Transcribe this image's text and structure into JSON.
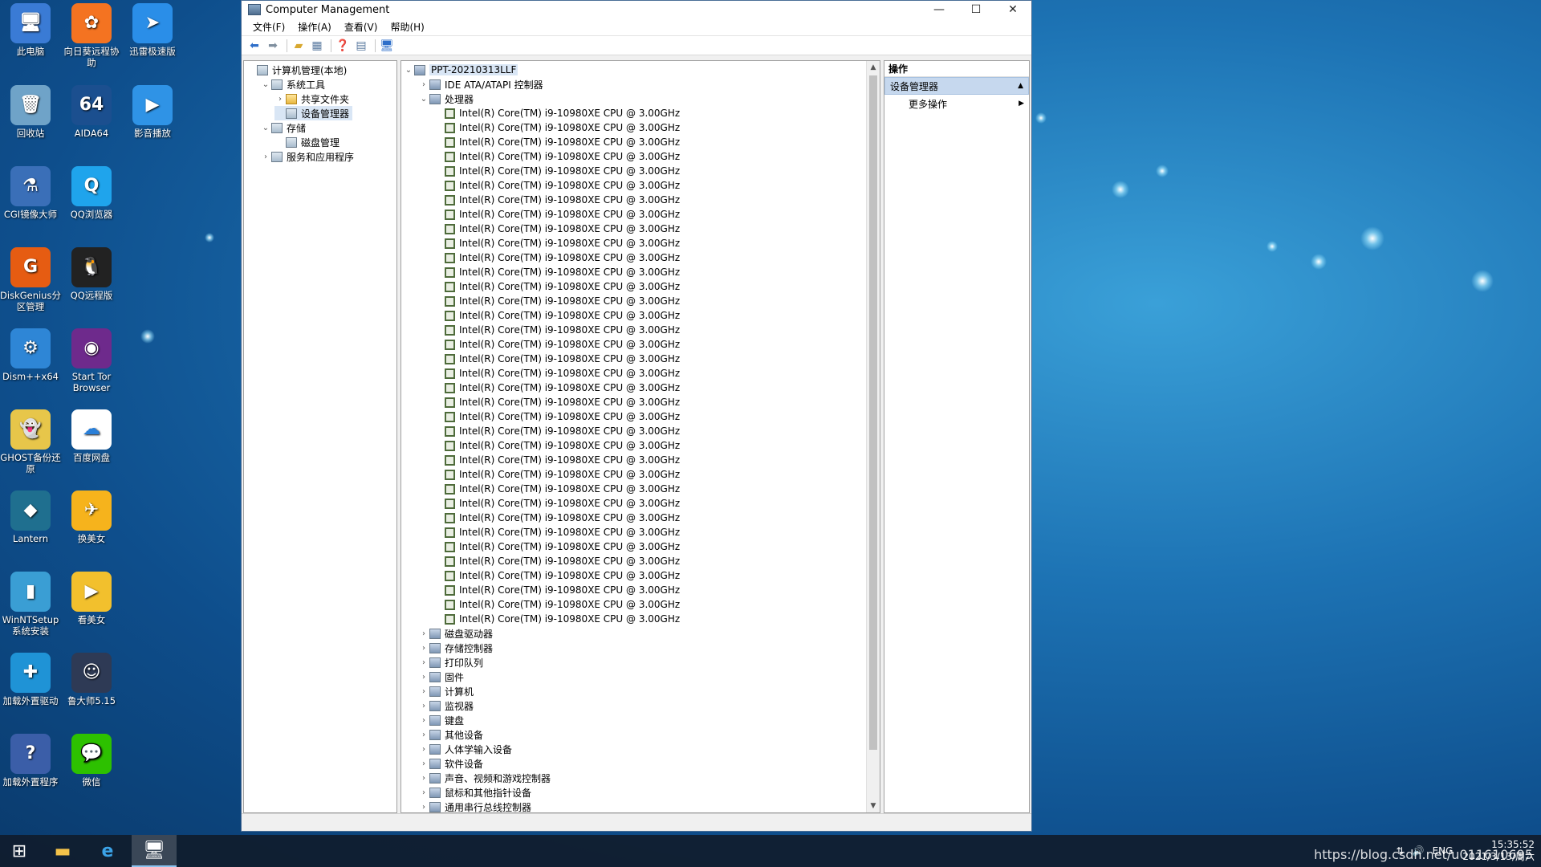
{
  "desktop": {
    "icons": [
      {
        "label": "此电脑",
        "glyph": "🖥",
        "color": "#3a7bd5"
      },
      {
        "label": "向日葵远程协助",
        "glyph": "✿",
        "color": "#f47321"
      },
      {
        "label": "迅雷极速版",
        "glyph": "➤",
        "color": "#2a8ee8"
      },
      {
        "label": "回收站",
        "glyph": "🗑",
        "color": "#6fa3c8"
      },
      {
        "label": "AIDA64",
        "glyph": "64",
        "color": "#1b4f8f"
      },
      {
        "label": "影音播放",
        "glyph": "▶",
        "color": "#2f93e6"
      },
      {
        "label": "CGI镜像大师",
        "glyph": "⚗",
        "color": "#3a6fb8"
      },
      {
        "label": "QQ浏览器",
        "glyph": "Q",
        "color": "#1fa4ec"
      },
      {
        "label": "DiskGenius分区管理",
        "glyph": "G",
        "color": "#e65c12"
      },
      {
        "label": "QQ远程版",
        "glyph": "🐧",
        "color": "#222222"
      },
      {
        "label": "Dism++x64",
        "glyph": "⚙",
        "color": "#2e86d6"
      },
      {
        "label": "Start Tor Browser",
        "glyph": "◉",
        "color": "#6e2a8c"
      },
      {
        "label": "GHOST备份还原",
        "glyph": "👻",
        "color": "#e7c64a"
      },
      {
        "label": "百度网盘",
        "glyph": "☁",
        "color": "#ffffff"
      },
      {
        "label": "Lantern",
        "glyph": "◆",
        "color": "#1f6f8f"
      },
      {
        "label": "换美女",
        "glyph": "✈",
        "color": "#f6b31c"
      },
      {
        "label": "WinNTSetup系统安装",
        "glyph": "▮",
        "color": "#3a9ed4"
      },
      {
        "label": "看美女",
        "glyph": "▶",
        "color": "#f2c02d"
      },
      {
        "label": "加载外置驱动",
        "glyph": "✚",
        "color": "#1f93d6"
      },
      {
        "label": "鲁大师5.15",
        "glyph": "☺",
        "color": "#2e3a55"
      },
      {
        "label": "加载外置程序",
        "glyph": "?",
        "color": "#3b5ea8"
      },
      {
        "label": "微信",
        "glyph": "💬",
        "color": "#2dc100"
      }
    ]
  },
  "window": {
    "title": "Computer Management",
    "controls": {
      "minimize": "—",
      "maximize": "☐",
      "close": "✕"
    },
    "menu": [
      "文件(F)",
      "操作(A)",
      "查看(V)",
      "帮助(H)"
    ],
    "toolbar": {
      "back": "back-arrow-icon",
      "forward": "forward-arrow-icon",
      "up": "up-folder-icon",
      "show_hide": "console-tree-icon",
      "help": "help-icon",
      "properties": "properties-icon",
      "monitor": "monitor-icon"
    },
    "left_tree": [
      {
        "label": "计算机管理(本地)",
        "level": 0,
        "arrow": ""
      },
      {
        "label": "系统工具",
        "level": 1,
        "arrow": "⌄"
      },
      {
        "label": "共享文件夹",
        "level": 2,
        "arrow": "›"
      },
      {
        "label": "设备管理器",
        "level": 2,
        "arrow": "",
        "selected": true
      },
      {
        "label": "存储",
        "level": 1,
        "arrow": "⌄"
      },
      {
        "label": "磁盘管理",
        "level": 2,
        "arrow": ""
      },
      {
        "label": "服务和应用程序",
        "level": 1,
        "arrow": "›"
      }
    ],
    "device_tree": {
      "root": "PPT-20210313LLF",
      "before": [
        {
          "label": "IDE ATA/ATAPI 控制器",
          "arrow": "›"
        },
        {
          "label": "处理器",
          "arrow": "⌄"
        }
      ],
      "cpu_label": "Intel(R) Core(TM) i9-10980XE CPU @ 3.00GHz",
      "cpu_count": 36,
      "after": [
        {
          "label": "磁盘驱动器",
          "arrow": "›"
        },
        {
          "label": "存储控制器",
          "arrow": "›"
        },
        {
          "label": "打印队列",
          "arrow": "›"
        },
        {
          "label": "固件",
          "arrow": "›"
        },
        {
          "label": "计算机",
          "arrow": "›"
        },
        {
          "label": "监视器",
          "arrow": "›"
        },
        {
          "label": "键盘",
          "arrow": "›"
        },
        {
          "label": "其他设备",
          "arrow": "›"
        },
        {
          "label": "人体学输入设备",
          "arrow": "›"
        },
        {
          "label": "软件设备",
          "arrow": "›"
        },
        {
          "label": "声音、视频和游戏控制器",
          "arrow": "›"
        },
        {
          "label": "鼠标和其他指针设备",
          "arrow": "›"
        },
        {
          "label": "通用串行总线控制器",
          "arrow": "›"
        }
      ]
    },
    "actions": {
      "header": "操作",
      "section": "设备管理器",
      "more": "更多操作"
    }
  },
  "taskbar": {
    "start": "start-icon",
    "apps": [
      "file-explorer-icon",
      "internet-explorer-icon",
      "computer-management-icon"
    ],
    "tray_lang": "ENG",
    "time": "15:35:52",
    "date": "2021/3/13/周六",
    "watermark": "https://blog.csdn.net/u011610695"
  }
}
